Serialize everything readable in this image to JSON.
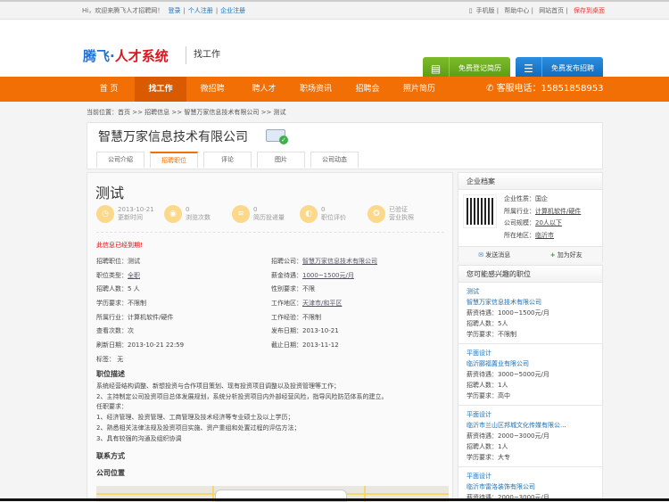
{
  "topbar": {
    "welcome": "Hi，欢迎来腾飞人才招聘网！",
    "login": "登录",
    "personal_reg": "个人注册",
    "company_reg": "企业注册",
    "mobile": "手机版",
    "help": "帮助中心",
    "home": "网站首页",
    "save_desktop": "保存到桌面"
  },
  "header": {
    "logo_blue": "腾飞·",
    "logo_red": "人才系统",
    "section": "找工作",
    "btn_resume": "免费登记简历",
    "btn_post": "免费发布招聘"
  },
  "nav": {
    "items": [
      "首 页",
      "找工作",
      "微招聘",
      "聘人才",
      "职场资讯",
      "招聘会",
      "照片简历"
    ],
    "phone": "客服电话：15851858953"
  },
  "breadcrumb": "当前位置：首页 >> 招聘信息 >> 智慧万家信息技术有限公司 >> 测试",
  "company": {
    "name": "智慧万家信息技术有限公司",
    "tabs": [
      "公司介绍",
      "招聘职位",
      "评论",
      "图片",
      "公司动态"
    ]
  },
  "job": {
    "title": "测试",
    "stats": [
      {
        "value": "2013-10-21",
        "label": "更新时间",
        "icon": "clock-icon"
      },
      {
        "value": "0",
        "label": "浏览次数",
        "icon": "eye-icon"
      },
      {
        "value": "0",
        "label": "简历投递量",
        "icon": "layers-icon"
      },
      {
        "value": "0",
        "label": "职位评价",
        "icon": "comment-icon"
      },
      {
        "value": "已验证",
        "label": "营业执照",
        "icon": "award-icon"
      }
    ],
    "expired": "此信息已经到期!",
    "fields": [
      [
        "招聘职位：测试",
        "招聘公司：",
        "智慧万家信息技术有限公司"
      ],
      [
        "职位类型：",
        "全职",
        "薪金待遇：",
        "1000~1500元/月"
      ],
      [
        "招聘人数：5 人",
        "性别要求：不限"
      ],
      [
        "学历要求：不限制",
        "工作地区：",
        "天津市/和平区"
      ],
      [
        "所属行业：计算机软件/硬件",
        "工作经验：不限制"
      ],
      [
        "查看次数：次",
        "发布日期：2013-10-21"
      ],
      [
        "刷新日期：2013-10-21 22:59",
        "截止日期：2013-11-12"
      ],
      [
        "标签： 无"
      ]
    ],
    "desc_title": "职位描述",
    "desc": [
      "系统经营结构调整、新想投资与合作项目策划、现有投资项目调整以及投资管理等工作；",
      "2、主持制定公司投资项目总体发展规划，系统分析投资项目内外部经营风险，指导风险防范体系的建立。",
      "任职要求：",
      "1、经济管理、投资管理、工商管理及技术经济等专业硕士及以上学历；",
      "2、熟悉相关法律法规及投资项目实施、资产重组和处置过程的评估方法；",
      "3、具有较强的沟通及组织协调"
    ],
    "contact_title": "联系方式",
    "location_title": "公司位置"
  },
  "profile": {
    "title": "企业档案",
    "nature": "企业性质：国企",
    "industry_label": "所属行业：",
    "industry": "计算机软件/硬件",
    "scale_label": "公司规模：",
    "scale": "20人以下",
    "area_label": "所在地区：",
    "area": "临沂市",
    "send_msg": "发送消息",
    "add_friend": "加为好友"
  },
  "interest": {
    "title": "您可能感兴趣的职位",
    "jobs": [
      {
        "title": "测试",
        "company": "智慧万家信息技术有限公司",
        "salary": "薪资待遇：1000~1500元/月",
        "count": "招聘人数：5人",
        "edu": "学历要求：不限制"
      },
      {
        "title": "平面设计",
        "company": "临沂郦福置业有限公司",
        "salary": "薪资待遇：3000~5000元/月",
        "count": "招聘人数：1人",
        "edu": "学历要求：高中"
      },
      {
        "title": "平面设计",
        "company": "临沂市兰山区邦城文化传媒有限公...",
        "salary": "薪资待遇：2000~3000元/月",
        "count": "招聘人数：1人",
        "edu": "学历要求：大专"
      },
      {
        "title": "平面设计",
        "company": "临沂市雷洛装饰有限公司",
        "salary": "薪资待遇：2000~3000元/月",
        "count": "",
        "edu": ""
      }
    ]
  }
}
